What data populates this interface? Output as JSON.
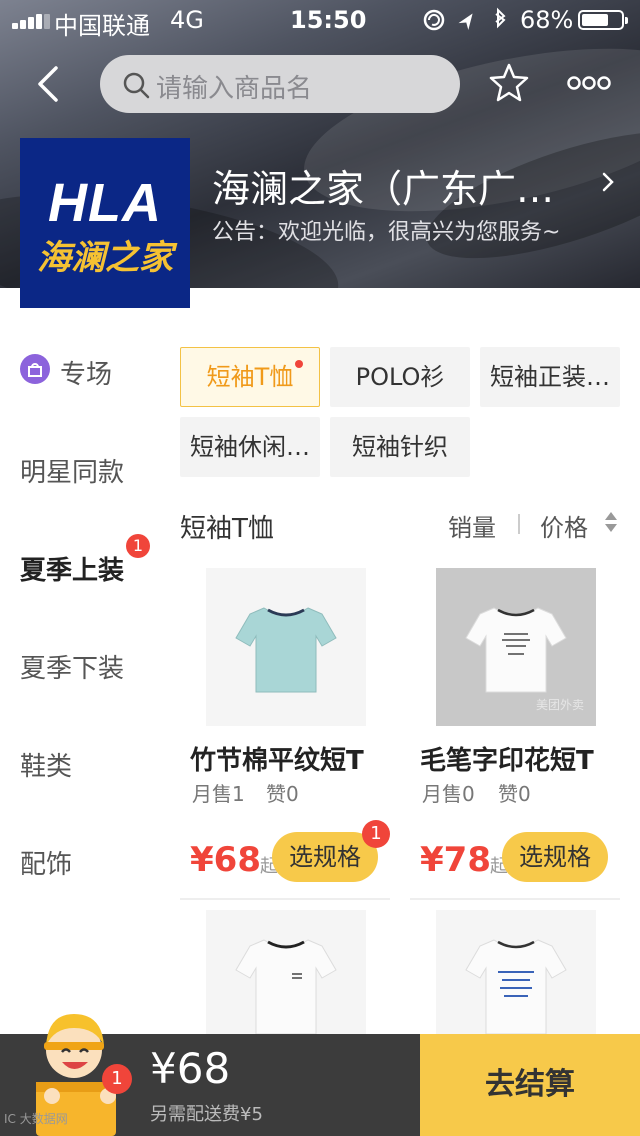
{
  "status_bar": {
    "carrier": "中国联通",
    "network": "4G",
    "time": "15:50",
    "battery_pct": "68%",
    "battery_level": 0.68
  },
  "header": {
    "search_placeholder": "请输入商品名",
    "shop_name": "海澜之家（广东广州南沙万达店）",
    "notice": "公告：欢迎光临，很高兴为您服务~"
  },
  "logo": {
    "text_en": "HLA",
    "text_cn": "海澜之家",
    "bg_color": "#0b2786",
    "text_color": "#f6c233"
  },
  "sidebar": {
    "items": [
      {
        "label": "专场"
      },
      {
        "label": "明星同款"
      },
      {
        "label": "夏季上装",
        "badge": "1"
      },
      {
        "label": "夏季下装"
      },
      {
        "label": "鞋类"
      },
      {
        "label": "配饰"
      }
    ]
  },
  "tags": [
    "短袖T恤",
    "POLO衫",
    "短袖正装衬衫",
    "短袖休闲衬衫",
    "短袖针织"
  ],
  "section": {
    "title": "短袖T恤",
    "sort_sales": "销量",
    "sort_price": "价格"
  },
  "products": [
    {
      "name": "竹节棉平纹短T",
      "sales": "月售1",
      "likes": "赞0",
      "price": "¥68",
      "qi": "起",
      "button": "选规格",
      "badge": "1"
    },
    {
      "name": "毛笔字印花短T",
      "sales": "月售0",
      "likes": "赞0",
      "price": "¥78",
      "qi": "起",
      "button": "选规格",
      "watermark": "美团外卖"
    }
  ],
  "cart": {
    "total": "¥68",
    "fee_note": "另需配送费¥5",
    "checkout": "去结算",
    "badge": "1",
    "watermark": "IC 大数据网"
  },
  "colors": {
    "accent": "#f7c94a",
    "price": "#f0453a",
    "active_tag_text": "#f09a1a"
  }
}
